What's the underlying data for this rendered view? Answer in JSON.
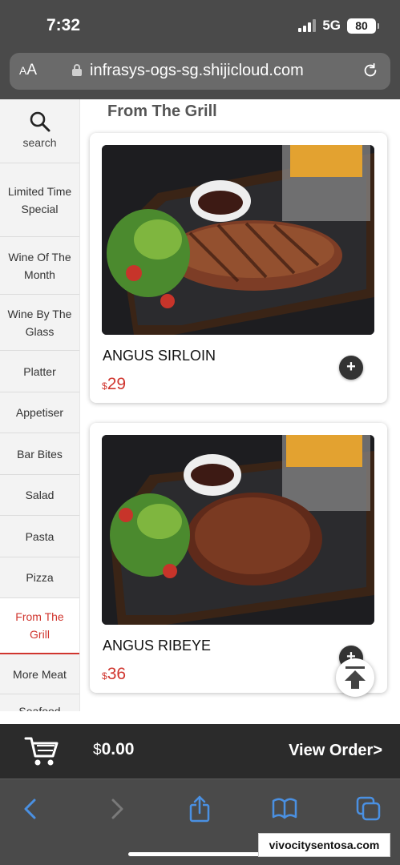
{
  "status_bar": {
    "time": "7:32",
    "network": "5G",
    "battery": "80"
  },
  "browser": {
    "text_size_label_small": "A",
    "text_size_label": "A",
    "url": "infrasys-ogs-sg.shijicloud.com"
  },
  "sidebar": {
    "search_label": "search",
    "items": [
      {
        "label": "Limited Time Special"
      },
      {
        "label": "Wine Of The Month"
      },
      {
        "label": "Wine By The Glass"
      },
      {
        "label": "Platter"
      },
      {
        "label": "Appetiser"
      },
      {
        "label": "Bar Bites"
      },
      {
        "label": "Salad"
      },
      {
        "label": "Pasta"
      },
      {
        "label": "Pizza"
      },
      {
        "label": "From The Grill"
      },
      {
        "label": "More Meat"
      },
      {
        "label": "Seafood"
      }
    ],
    "active": "From The Grill"
  },
  "main": {
    "section_title": "From The Grill",
    "items": [
      {
        "name": "ANGUS SIRLOIN",
        "currency": "$",
        "price": "29",
        "add": "+"
      },
      {
        "name": "ANGUS RIBEYE",
        "currency": "$",
        "price": "36",
        "add": "+"
      }
    ]
  },
  "cart": {
    "currency": "$",
    "total": "0.00",
    "view_order": "View Order>"
  },
  "watermark": "vivocitysentosa.com",
  "colors": {
    "accent": "#d0352e",
    "chrome": "#4a4a4a",
    "cart_bar": "#2b2b2b",
    "ios_blue": "#4a90e2"
  }
}
